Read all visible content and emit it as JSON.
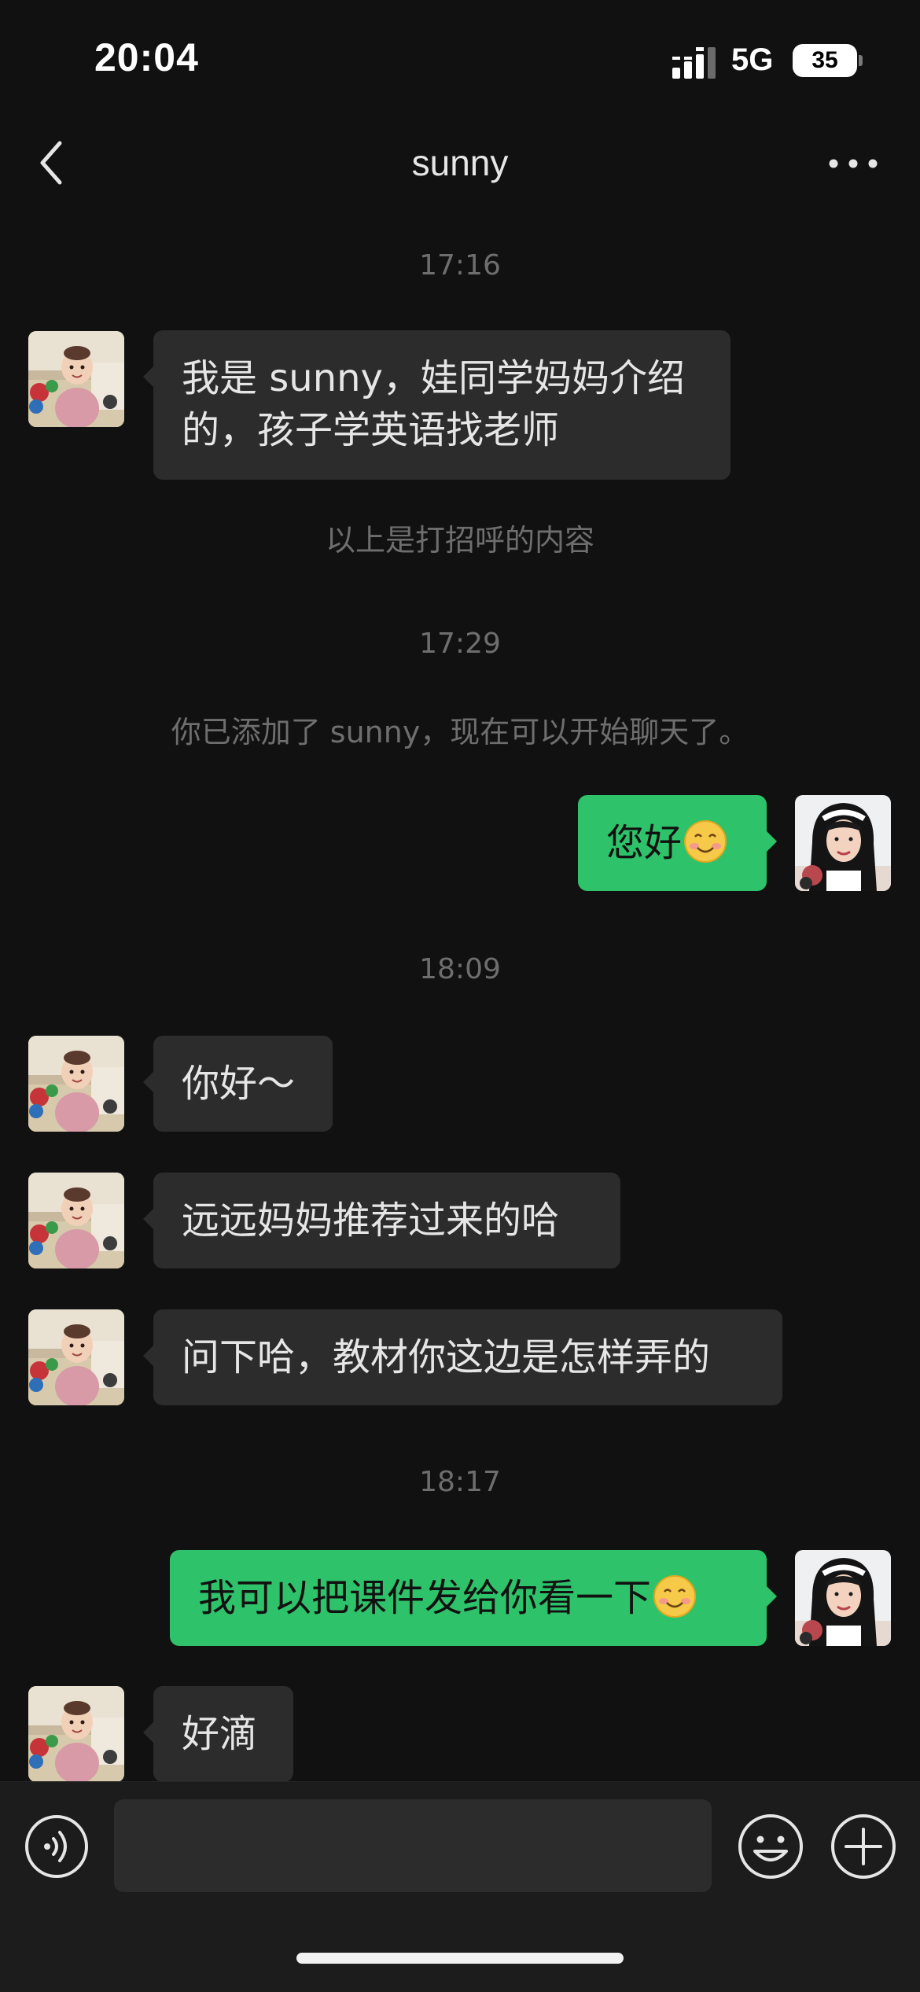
{
  "status_bar": {
    "time": "20:04",
    "network": "5G",
    "battery": "35",
    "signal_icon": "signal-bars-icon"
  },
  "header": {
    "title": "sunny",
    "back_icon": "chevron-left-icon",
    "more_icon": "more-dots-icon"
  },
  "messages": {
    "t1": "17:16",
    "m1_line1": "我是 sunny，娃同学妈妈介绍",
    "m1_line2": "的，孩子学英语找老师",
    "note_greeting": "以上是打招呼的内容",
    "t2": "17:29",
    "note_added": "你已添加了 sunny，现在可以开始聊天了。",
    "m2": "您好",
    "t3": "18:09",
    "m3": "你好～",
    "m4": "远远妈妈推荐过来的哈",
    "m5": "问下哈，教材你这边是怎样弄的",
    "t4": "18:17",
    "m6": "我可以把课件发给你看一下",
    "m7": "好滴"
  },
  "input_bar": {
    "voice_icon": "voice-icon",
    "emoji_icon": "emoji-icon",
    "add_icon": "plus-circle-icon"
  },
  "colors": {
    "background": "#111111",
    "incoming_bubble": "#2c2c2c",
    "outgoing_bubble": "#2ec26a",
    "meta_text": "#6e6e6e"
  }
}
